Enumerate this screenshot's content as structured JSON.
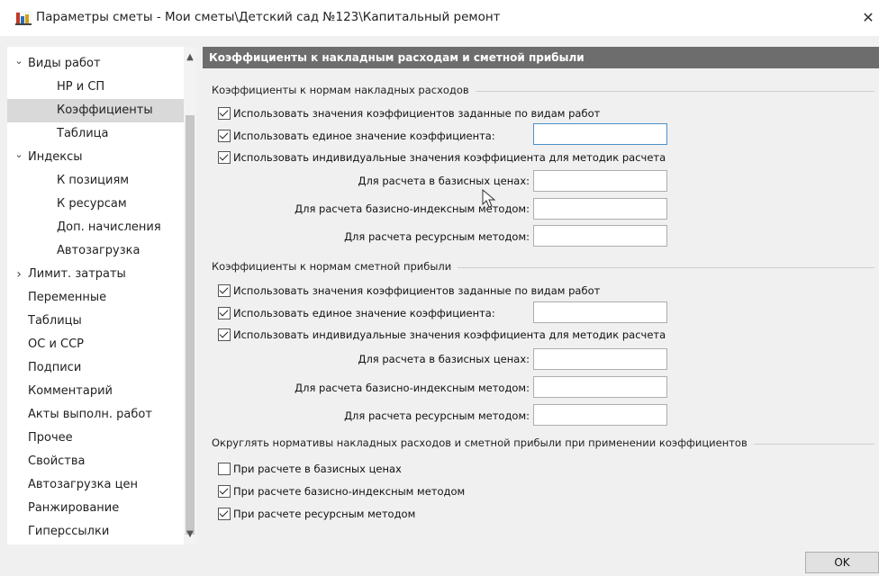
{
  "window": {
    "title": "Параметры сметы - Мои сметы\\Детский сад №123\\Капитальный ремонт",
    "close_glyph": "✕",
    "icon": "app-chart-icon"
  },
  "sidebar": {
    "items": [
      {
        "label": "Виды работ",
        "level": 0,
        "expanded": true
      },
      {
        "label": "НР и СП",
        "level": 1
      },
      {
        "label": "Коэффициенты",
        "level": 1,
        "selected": true
      },
      {
        "label": "Таблица",
        "level": 1
      },
      {
        "label": "Индексы",
        "level": 0,
        "expanded": true
      },
      {
        "label": "К позициям",
        "level": 1
      },
      {
        "label": "К ресурсам",
        "level": 1
      },
      {
        "label": "Доп. начисления",
        "level": 1
      },
      {
        "label": "Автозагрузка",
        "level": 1
      },
      {
        "label": "Лимит. затраты",
        "level": 0,
        "expanded": false
      },
      {
        "label": "Переменные",
        "level": 0
      },
      {
        "label": "Таблицы",
        "level": 0
      },
      {
        "label": "ОС и ССР",
        "level": 0
      },
      {
        "label": "Подписи",
        "level": 0
      },
      {
        "label": "Комментарий",
        "level": 0
      },
      {
        "label": "Акты выполн. работ",
        "level": 0
      },
      {
        "label": "Прочее",
        "level": 0
      },
      {
        "label": "Свойства",
        "level": 0
      },
      {
        "label": "Автозагрузка цен",
        "level": 0
      },
      {
        "label": "Ранжирование",
        "level": 0
      },
      {
        "label": "Гиперссылки",
        "level": 0
      }
    ],
    "arrow_expanded": "⌄",
    "arrow_collapsed": "›",
    "scroll_up": "▲",
    "scroll_down": "▼"
  },
  "content": {
    "header": "Коэффициенты к накладным расходам и сметной прибыли",
    "overhead": {
      "title": "Коэффициенты к нормам накладных расходов",
      "use_by_work_types": "Использовать значения коэффициентов заданные по видам работ",
      "use_single": "Использовать единое значение коэффициента:",
      "use_individual": "Использовать индивидуальные значения коэффициента для методик расчета",
      "base_prices": "Для расчета в базисных ценах:",
      "base_index": "Для расчета базисно-индексным методом:",
      "resource": "Для расчета ресурсным методом:"
    },
    "profit": {
      "title": "Коэффициенты к нормам сметной прибыли",
      "use_by_work_types": "Использовать значения коэффициентов заданные по видам работ",
      "use_single": "Использовать единое значение коэффициента:",
      "use_individual": "Использовать индивидуальные значения коэффициента для методик расчета",
      "base_prices": "Для расчета в базисных ценах:",
      "base_index": "Для расчета базисно-индексным методом:",
      "resource": "Для расчета ресурсным методом:"
    },
    "rounding": {
      "title": "Округлять нормативы накладных расходов и сметной прибыли при применении коэффициентов",
      "base_prices": "При расчете в базисных ценах",
      "base_index": "При расчете базисно-индексным методом",
      "resource": "При расчете ресурсным методом"
    }
  },
  "footer": {
    "ok_label": "OK"
  }
}
